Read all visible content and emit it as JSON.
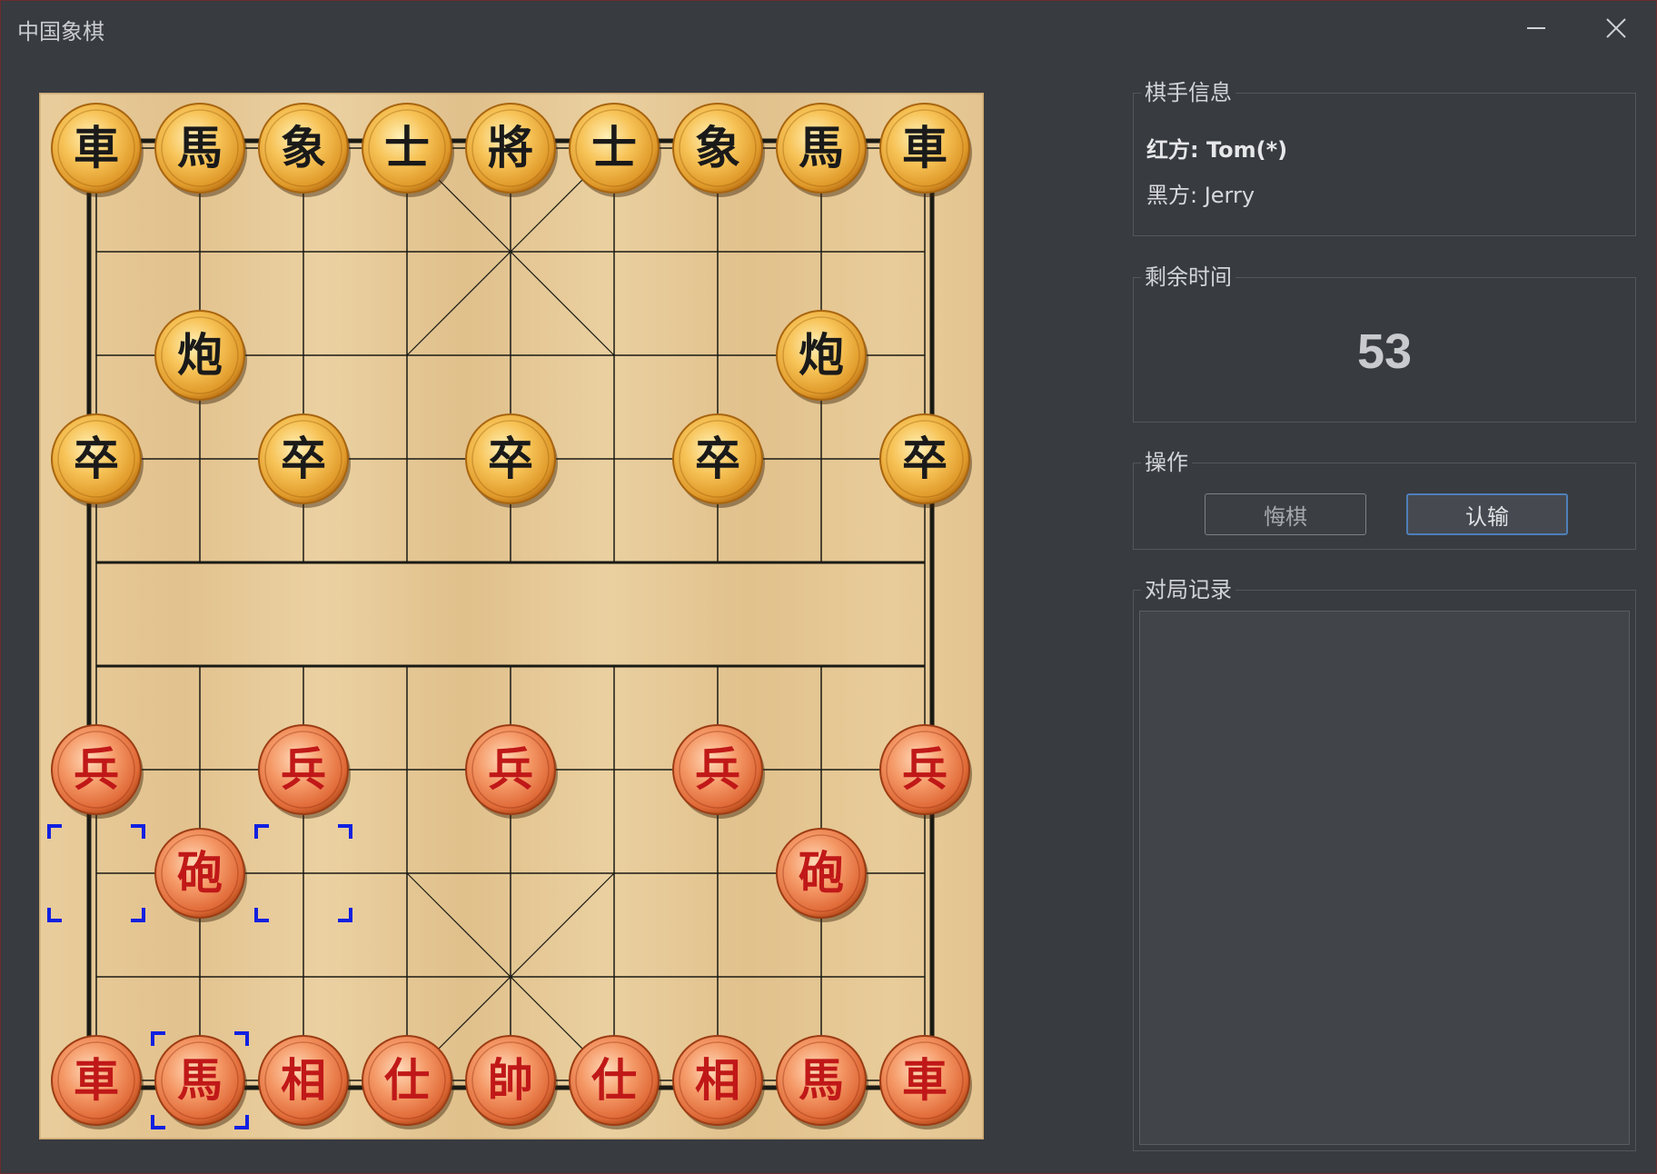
{
  "window": {
    "title": "中国象棋",
    "minimize_icon": "minimize-icon",
    "close_icon": "close-icon"
  },
  "players": {
    "group_title": "棋手信息",
    "red": "红方: Tom(*)",
    "black": "黑方: Jerry"
  },
  "timer": {
    "group_title": "剩余时间",
    "value": "53"
  },
  "actions": {
    "group_title": "操作",
    "undo_label": "悔棋",
    "resign_label": "认输"
  },
  "record": {
    "group_title": "对局记录",
    "moves": []
  },
  "colors": {
    "board_wood": "#e5c795",
    "board_line": "#1a1a14",
    "black_piece_text": "#1a1a1a",
    "red_piece_text": "#c01818",
    "black_piece_face": "#f0b040",
    "red_piece_face": "#f08050",
    "selection": "#1020e0",
    "accent_button_border": "#4e7fb8"
  },
  "board": {
    "files": 9,
    "ranks": 10,
    "pieces": [
      {
        "side": "black",
        "glyph": "車",
        "file": 0,
        "rank": 0
      },
      {
        "side": "black",
        "glyph": "馬",
        "file": 1,
        "rank": 0
      },
      {
        "side": "black",
        "glyph": "象",
        "file": 2,
        "rank": 0
      },
      {
        "side": "black",
        "glyph": "士",
        "file": 3,
        "rank": 0
      },
      {
        "side": "black",
        "glyph": "將",
        "file": 4,
        "rank": 0
      },
      {
        "side": "black",
        "glyph": "士",
        "file": 5,
        "rank": 0
      },
      {
        "side": "black",
        "glyph": "象",
        "file": 6,
        "rank": 0
      },
      {
        "side": "black",
        "glyph": "馬",
        "file": 7,
        "rank": 0
      },
      {
        "side": "black",
        "glyph": "車",
        "file": 8,
        "rank": 0
      },
      {
        "side": "black",
        "glyph": "炮",
        "file": 1,
        "rank": 2
      },
      {
        "side": "black",
        "glyph": "炮",
        "file": 7,
        "rank": 2
      },
      {
        "side": "black",
        "glyph": "卒",
        "file": 0,
        "rank": 3
      },
      {
        "side": "black",
        "glyph": "卒",
        "file": 2,
        "rank": 3
      },
      {
        "side": "black",
        "glyph": "卒",
        "file": 4,
        "rank": 3
      },
      {
        "side": "black",
        "glyph": "卒",
        "file": 6,
        "rank": 3
      },
      {
        "side": "black",
        "glyph": "卒",
        "file": 8,
        "rank": 3
      },
      {
        "side": "red",
        "glyph": "兵",
        "file": 0,
        "rank": 6
      },
      {
        "side": "red",
        "glyph": "兵",
        "file": 2,
        "rank": 6
      },
      {
        "side": "red",
        "glyph": "兵",
        "file": 4,
        "rank": 6
      },
      {
        "side": "red",
        "glyph": "兵",
        "file": 6,
        "rank": 6
      },
      {
        "side": "red",
        "glyph": "兵",
        "file": 8,
        "rank": 6
      },
      {
        "side": "red",
        "glyph": "砲",
        "file": 1,
        "rank": 7
      },
      {
        "side": "red",
        "glyph": "砲",
        "file": 7,
        "rank": 7
      },
      {
        "side": "red",
        "glyph": "車",
        "file": 0,
        "rank": 9
      },
      {
        "side": "red",
        "glyph": "馬",
        "file": 1,
        "rank": 9
      },
      {
        "side": "red",
        "glyph": "相",
        "file": 2,
        "rank": 9
      },
      {
        "side": "red",
        "glyph": "仕",
        "file": 3,
        "rank": 9
      },
      {
        "side": "red",
        "glyph": "帥",
        "file": 4,
        "rank": 9
      },
      {
        "side": "red",
        "glyph": "仕",
        "file": 5,
        "rank": 9
      },
      {
        "side": "red",
        "glyph": "相",
        "file": 6,
        "rank": 9
      },
      {
        "side": "red",
        "glyph": "馬",
        "file": 7,
        "rank": 9
      },
      {
        "side": "red",
        "glyph": "車",
        "file": 8,
        "rank": 9
      }
    ],
    "selected": {
      "file": 1,
      "rank": 9
    },
    "move_hints": [
      {
        "file": 0,
        "rank": 7
      },
      {
        "file": 2,
        "rank": 7
      }
    ]
  }
}
